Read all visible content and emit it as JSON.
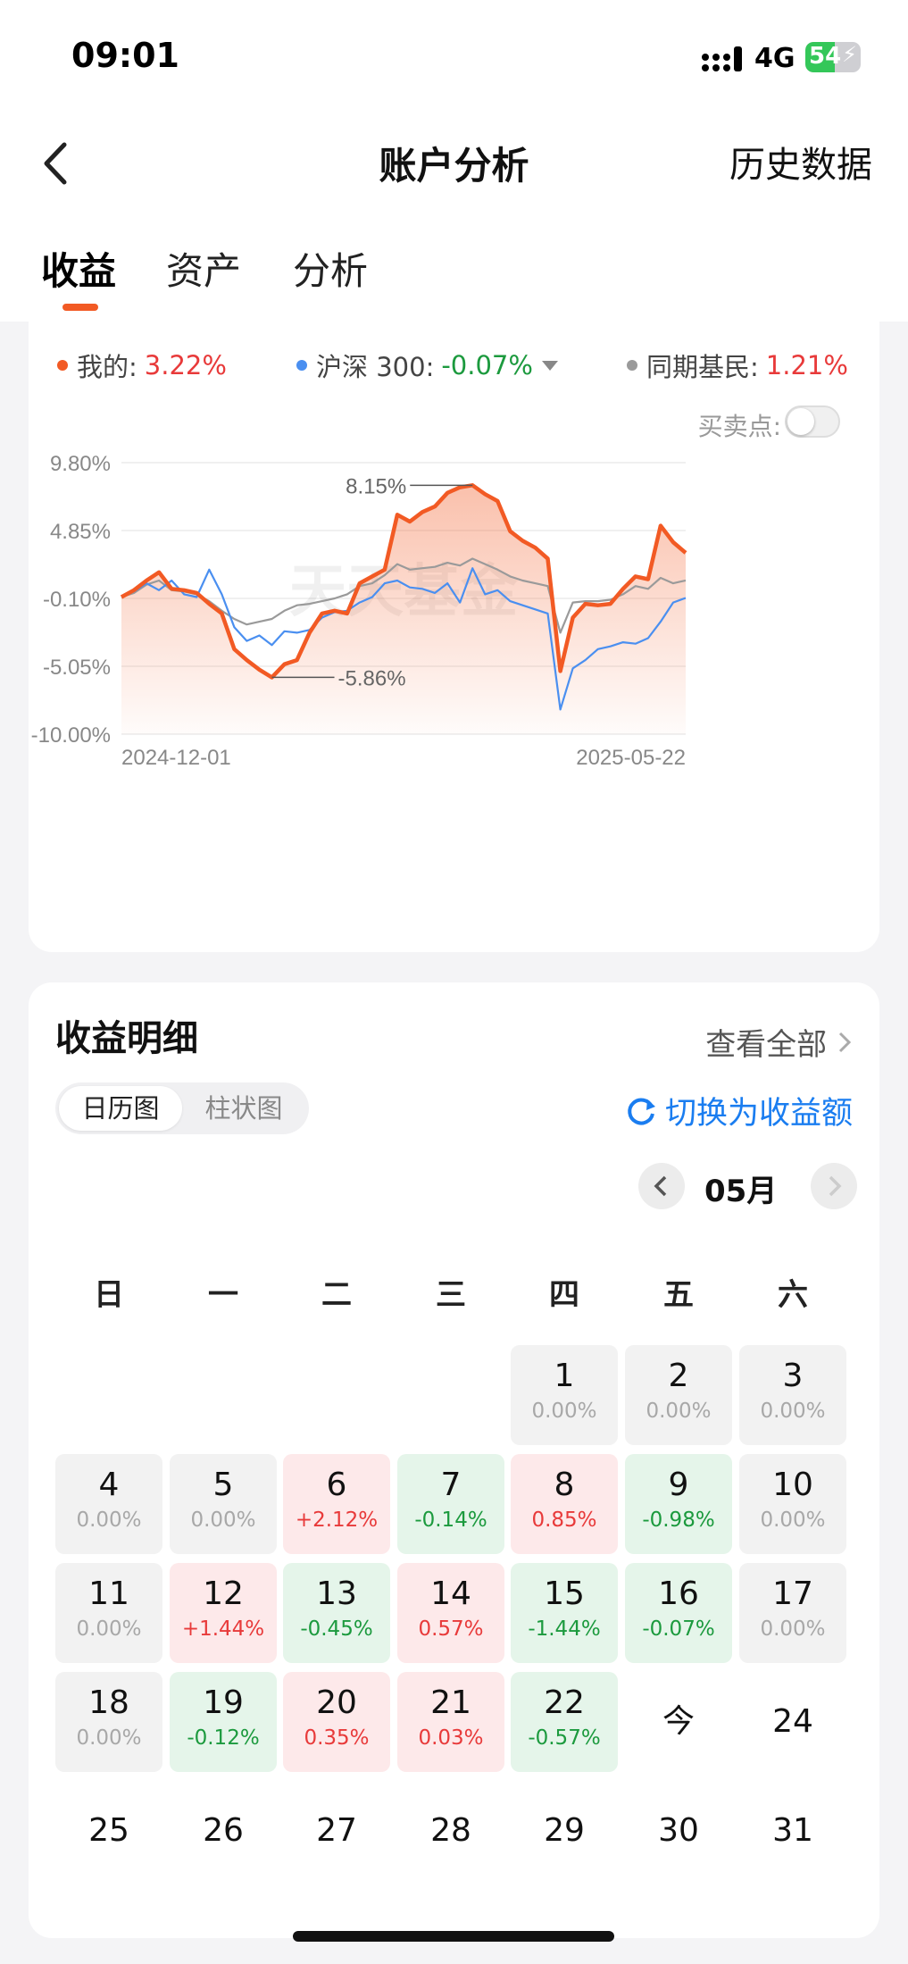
{
  "status": {
    "time": "09:01",
    "network": "4G",
    "battery": "54",
    "battery_level": 0.54
  },
  "header": {
    "title": "账户分析",
    "history": "历史数据"
  },
  "tabs": [
    "收益",
    "资产",
    "分析"
  ],
  "legend": {
    "mine_label": "我的:",
    "mine_value": "3.22%",
    "index_label": "沪深 300:",
    "index_value": "-0.07%",
    "peer_label": "同期基民:",
    "peer_value": "1.21%"
  },
  "buy_sell": {
    "label": "买卖点:",
    "on": false
  },
  "colors": {
    "mine": "#f25a24",
    "index": "#4a8ff0",
    "peer": "#9a9a9a",
    "up": "#e83a3a",
    "down": "#1c9a3e",
    "accent": "#1a7df0"
  },
  "chart_data": {
    "type": "line",
    "y_ticks": [
      "9.80%",
      "4.85%",
      "-0.10%",
      "-5.05%",
      "-10.00%"
    ],
    "ylim": [
      -10.0,
      9.8
    ],
    "x_labels": [
      "2024-12-01",
      "2025-05-22"
    ],
    "watermark": "天天基金",
    "max_label": "8.15%",
    "min_label": "-5.86%",
    "series": [
      {
        "name": "我的",
        "values": [
          0,
          0.5,
          1.2,
          1.8,
          0.6,
          0.5,
          0.3,
          -0.5,
          -1.2,
          -3.8,
          -4.6,
          -5.3,
          -5.86,
          -4.9,
          -4.6,
          -2.6,
          -1.2,
          -1.0,
          -1.2,
          1.0,
          1.5,
          2.0,
          6.0,
          5.5,
          6.2,
          6.6,
          7.6,
          8.0,
          8.15,
          7.5,
          7.0,
          4.8,
          4.1,
          3.6,
          2.8,
          -5.4,
          -1.5,
          -0.5,
          -0.6,
          -0.5,
          0.6,
          1.5,
          1.3,
          5.2,
          4.0,
          3.22
        ]
      },
      {
        "name": "沪深 300",
        "values": [
          0,
          0.4,
          1.0,
          0.5,
          1.2,
          0.2,
          0.0,
          2.0,
          0.2,
          -2.2,
          -3.2,
          -2.8,
          -3.5,
          -2.5,
          -2.6,
          -2.4,
          -1.5,
          -1.1,
          -1.0,
          -0.4,
          0.0,
          1.0,
          1.2,
          0.7,
          0.6,
          0.3,
          1.0,
          -0.4,
          2.1,
          0.2,
          0.5,
          -0.3,
          -0.6,
          -0.9,
          -1.2,
          -8.2,
          -5.2,
          -4.6,
          -3.8,
          -3.6,
          -3.3,
          -3.4,
          -3.0,
          -1.8,
          -0.4,
          -0.07
        ]
      },
      {
        "name": "同期基民",
        "values": [
          0,
          0.3,
          0.9,
          1.2,
          0.5,
          0.4,
          0.2,
          -0.3,
          -1.0,
          -1.6,
          -2.0,
          -1.8,
          -1.6,
          -1.0,
          -0.6,
          -0.5,
          -0.3,
          -0.1,
          0.2,
          0.8,
          1.0,
          1.6,
          2.4,
          2.0,
          2.1,
          2.2,
          2.5,
          2.3,
          2.8,
          2.4,
          2.0,
          1.5,
          1.2,
          1.0,
          0.8,
          -2.6,
          -0.4,
          -0.3,
          -0.3,
          -0.2,
          0.2,
          0.8,
          0.6,
          1.4,
          1.0,
          1.21
        ]
      }
    ]
  },
  "detail": {
    "title": "收益明细",
    "view_all": "查看全部",
    "seg_calendar": "日历图",
    "seg_bar": "柱状图",
    "switch_label": "切换为收益额",
    "month": "05月",
    "weekdays": [
      "日",
      "一",
      "二",
      "三",
      "四",
      "五",
      "六"
    ],
    "days": [
      {
        "d": "1",
        "v": "0.00%",
        "t": "gray"
      },
      {
        "d": "2",
        "v": "0.00%",
        "t": "gray"
      },
      {
        "d": "3",
        "v": "0.00%",
        "t": "gray"
      },
      {
        "d": "4",
        "v": "0.00%",
        "t": "gray"
      },
      {
        "d": "5",
        "v": "0.00%",
        "t": "gray"
      },
      {
        "d": "6",
        "v": "+2.12%",
        "t": "up"
      },
      {
        "d": "7",
        "v": "-0.14%",
        "t": "down"
      },
      {
        "d": "8",
        "v": "0.85%",
        "t": "up"
      },
      {
        "d": "9",
        "v": "-0.98%",
        "t": "down"
      },
      {
        "d": "10",
        "v": "0.00%",
        "t": "gray"
      },
      {
        "d": "11",
        "v": "0.00%",
        "t": "gray"
      },
      {
        "d": "12",
        "v": "+1.44%",
        "t": "up"
      },
      {
        "d": "13",
        "v": "-0.45%",
        "t": "down"
      },
      {
        "d": "14",
        "v": "0.57%",
        "t": "up"
      },
      {
        "d": "15",
        "v": "-1.44%",
        "t": "down"
      },
      {
        "d": "16",
        "v": "-0.07%",
        "t": "down"
      },
      {
        "d": "17",
        "v": "0.00%",
        "t": "gray"
      },
      {
        "d": "18",
        "v": "0.00%",
        "t": "gray"
      },
      {
        "d": "19",
        "v": "-0.12%",
        "t": "down"
      },
      {
        "d": "20",
        "v": "0.35%",
        "t": "up"
      },
      {
        "d": "21",
        "v": "0.03%",
        "t": "up"
      },
      {
        "d": "22",
        "v": "-0.57%",
        "t": "down"
      },
      {
        "d": "今",
        "v": "",
        "t": "plain"
      },
      {
        "d": "24",
        "v": "",
        "t": "plain"
      },
      {
        "d": "25",
        "v": "",
        "t": "plain"
      },
      {
        "d": "26",
        "v": "",
        "t": "plain"
      },
      {
        "d": "27",
        "v": "",
        "t": "plain"
      },
      {
        "d": "28",
        "v": "",
        "t": "plain"
      },
      {
        "d": "29",
        "v": "",
        "t": "plain"
      },
      {
        "d": "30",
        "v": "",
        "t": "plain"
      },
      {
        "d": "31",
        "v": "",
        "t": "plain"
      }
    ]
  }
}
